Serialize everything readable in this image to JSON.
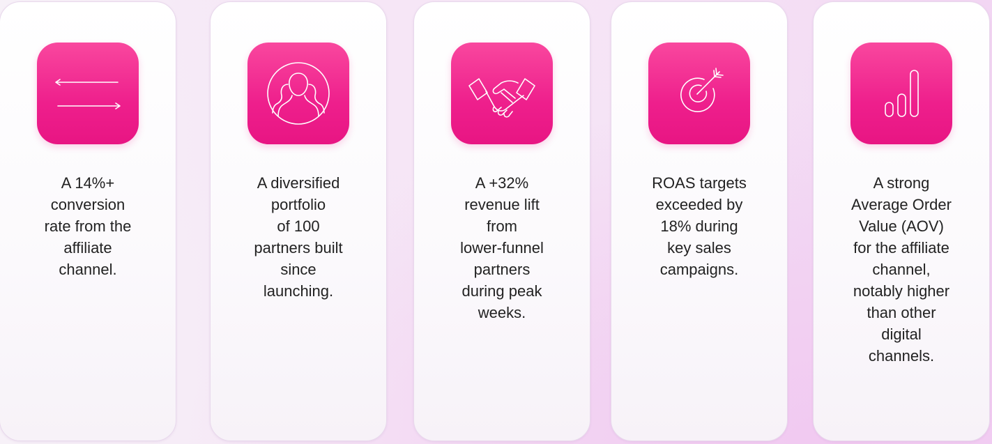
{
  "cards": [
    {
      "icon": "arrows-exchange-icon",
      "lines": [
        "A 14%+",
        "conversion",
        "rate from the",
        "affiliate",
        "channel."
      ]
    },
    {
      "icon": "people-group-icon",
      "lines": [
        "A diversified",
        "portfolio",
        "of 100",
        "partners built",
        "since",
        "launching."
      ]
    },
    {
      "icon": "handshake-icon",
      "lines": [
        "A +32%",
        "revenue lift",
        "from",
        "lower-funnel",
        "partners",
        "during peak",
        "weeks."
      ]
    },
    {
      "icon": "target-arrow-icon",
      "lines": [
        "ROAS targets",
        "exceeded by",
        "18% during",
        "key sales",
        "campaigns."
      ]
    },
    {
      "icon": "bar-chart-icon",
      "lines": [
        "A strong",
        "Average Order",
        "Value (AOV)",
        "for the affiliate",
        "channel,",
        "notably higher",
        "than other",
        "digital",
        "channels."
      ]
    }
  ],
  "colors": {
    "accent": "#ee1f8c",
    "text": "#222222",
    "card": "#ffffff"
  }
}
